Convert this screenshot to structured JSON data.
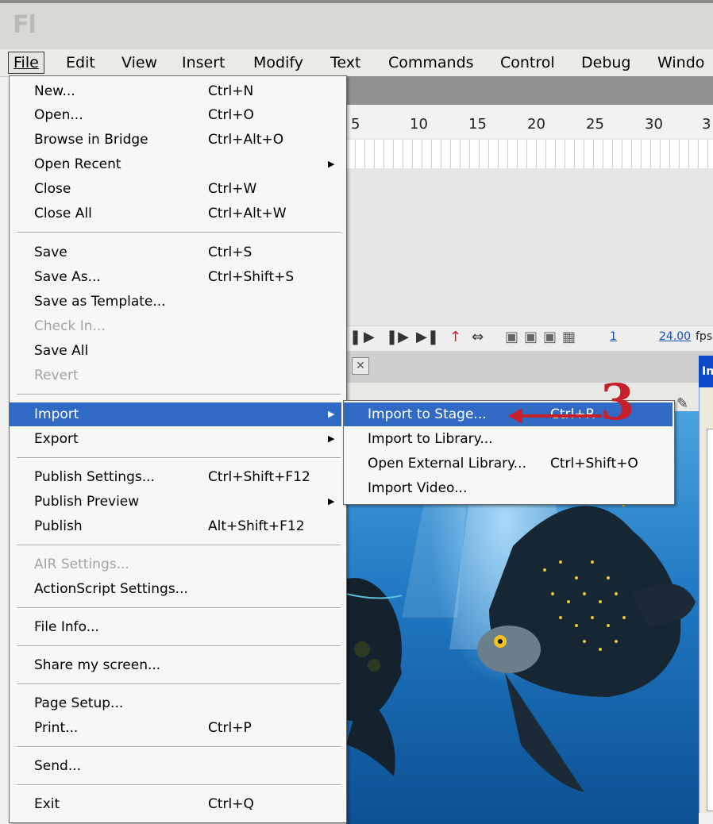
{
  "app": {
    "logo": "Fl"
  },
  "menubar": {
    "items": [
      {
        "label": "File"
      },
      {
        "label": "Edit"
      },
      {
        "label": "View"
      },
      {
        "label": "Insert"
      },
      {
        "label": "Modify"
      },
      {
        "label": "Text"
      },
      {
        "label": "Commands"
      },
      {
        "label": "Control"
      },
      {
        "label": "Debug"
      },
      {
        "label": "Windo"
      }
    ]
  },
  "timeline": {
    "ruler": [
      "5",
      "10",
      "15",
      "20",
      "25",
      "30",
      "3"
    ],
    "frame_number": "1",
    "fps_value": "24.00",
    "fps_unit": "fps"
  },
  "dialog": {
    "title_fragment": "In"
  },
  "file_menu": {
    "items": [
      {
        "label": "New...",
        "shortcut": "Ctrl+N"
      },
      {
        "label": "Open...",
        "shortcut": "Ctrl+O"
      },
      {
        "label": "Browse in Bridge",
        "shortcut": "Ctrl+Alt+O"
      },
      {
        "label": "Open Recent",
        "shortcut": ""
      },
      {
        "label": "Close",
        "shortcut": "Ctrl+W"
      },
      {
        "label": "Close All",
        "shortcut": "Ctrl+Alt+W"
      },
      {
        "label": "Save",
        "shortcut": "Ctrl+S"
      },
      {
        "label": "Save As...",
        "shortcut": "Ctrl+Shift+S"
      },
      {
        "label": "Save as Template...",
        "shortcut": ""
      },
      {
        "label": "Check In...",
        "shortcut": ""
      },
      {
        "label": "Save All",
        "shortcut": ""
      },
      {
        "label": "Revert",
        "shortcut": ""
      },
      {
        "label": "Import",
        "shortcut": ""
      },
      {
        "label": "Export",
        "shortcut": ""
      },
      {
        "label": "Publish Settings...",
        "shortcut": "Ctrl+Shift+F12"
      },
      {
        "label": "Publish Preview",
        "shortcut": ""
      },
      {
        "label": "Publish",
        "shortcut": "Alt+Shift+F12"
      },
      {
        "label": "AIR Settings...",
        "shortcut": ""
      },
      {
        "label": "ActionScript Settings...",
        "shortcut": ""
      },
      {
        "label": "File Info...",
        "shortcut": ""
      },
      {
        "label": "Share my screen...",
        "shortcut": ""
      },
      {
        "label": "Page Setup...",
        "shortcut": ""
      },
      {
        "label": "Print...",
        "shortcut": "Ctrl+P"
      },
      {
        "label": "Send...",
        "shortcut": ""
      },
      {
        "label": "Exit",
        "shortcut": "Ctrl+Q"
      }
    ]
  },
  "import_submenu": {
    "items": [
      {
        "label": "Import to Stage...",
        "shortcut": "Ctrl+R"
      },
      {
        "label": "Import to Library...",
        "shortcut": ""
      },
      {
        "label": "Open External Library...",
        "shortcut": "Ctrl+Shift+O"
      },
      {
        "label": "Import Video...",
        "shortcut": ""
      }
    ]
  },
  "annotation": {
    "step": "3",
    "color": "#c8202a"
  },
  "colors": {
    "selection": "#316ac5",
    "menu_bg": "#f7f7f5"
  }
}
